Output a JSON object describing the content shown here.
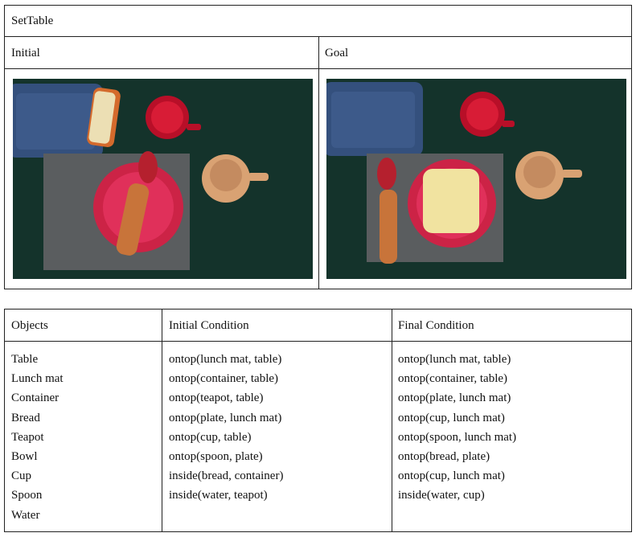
{
  "task": {
    "title": "SetTable",
    "initial_label": "Initial",
    "goal_label": "Goal"
  },
  "images": {
    "initial": {
      "description_icon": "photo-initial-scene"
    },
    "goal": {
      "description_icon": "photo-goal-scene"
    }
  },
  "conditions_table": {
    "headers": [
      "Objects",
      "Initial Condition",
      "Final Condition"
    ],
    "objects": [
      "Table",
      "Lunch mat",
      "Container",
      "Bread",
      "Teapot",
      "Bowl",
      "Cup",
      "Spoon",
      "Water"
    ],
    "initial_conditions": [
      "ontop(lunch mat, table)",
      "ontop(container, table)",
      "ontop(teapot, table)",
      "ontop(plate, lunch mat)",
      "ontop(cup, table)",
      "ontop(spoon, plate)",
      "inside(bread, container)",
      "inside(water, teapot)"
    ],
    "final_conditions": [
      "ontop(lunch mat, table)",
      "ontop(container, table)",
      "ontop(plate, lunch mat)",
      "ontop(cup, lunch mat)",
      "ontop(spoon, lunch mat)",
      "ontop(bread, plate)",
      "ontop(cup, lunch mat)",
      "inside(water, cup)"
    ]
  },
  "colors": {
    "table_surface": "#14332b",
    "container": "#3d5a8a",
    "plate": "#d92a4e",
    "cup": "#c8102e",
    "teapot": "#d9a273",
    "spoon": "#c8743a",
    "bread": "#f1e3a0",
    "lunch_mat": "#5a5d5f"
  }
}
